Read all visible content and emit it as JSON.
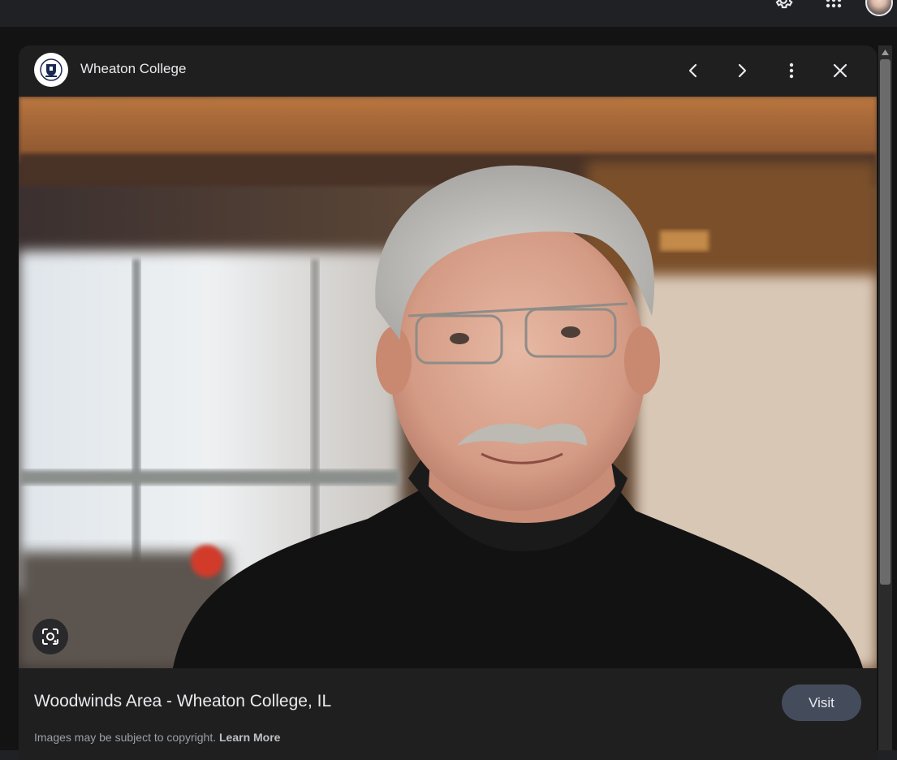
{
  "topbar": {
    "icons": [
      "settings-gear-icon",
      "apps-grid-icon"
    ]
  },
  "panel": {
    "site_name": "Wheaton College",
    "header_icons": [
      "chevron-left-icon",
      "chevron-right-icon",
      "more-vertical-icon",
      "close-icon"
    ],
    "caption": "Woodwinds Area - Wheaton College, IL",
    "visit_label": "Visit",
    "copyright_text": "Images may be subject to copyright.",
    "learn_more_label": "Learn More"
  },
  "colors": {
    "background": "#202124",
    "panel": "#1f1f1f",
    "visit_button": "#444c5c",
    "text_primary": "#e8eaed",
    "text_secondary": "#9aa0a6"
  }
}
